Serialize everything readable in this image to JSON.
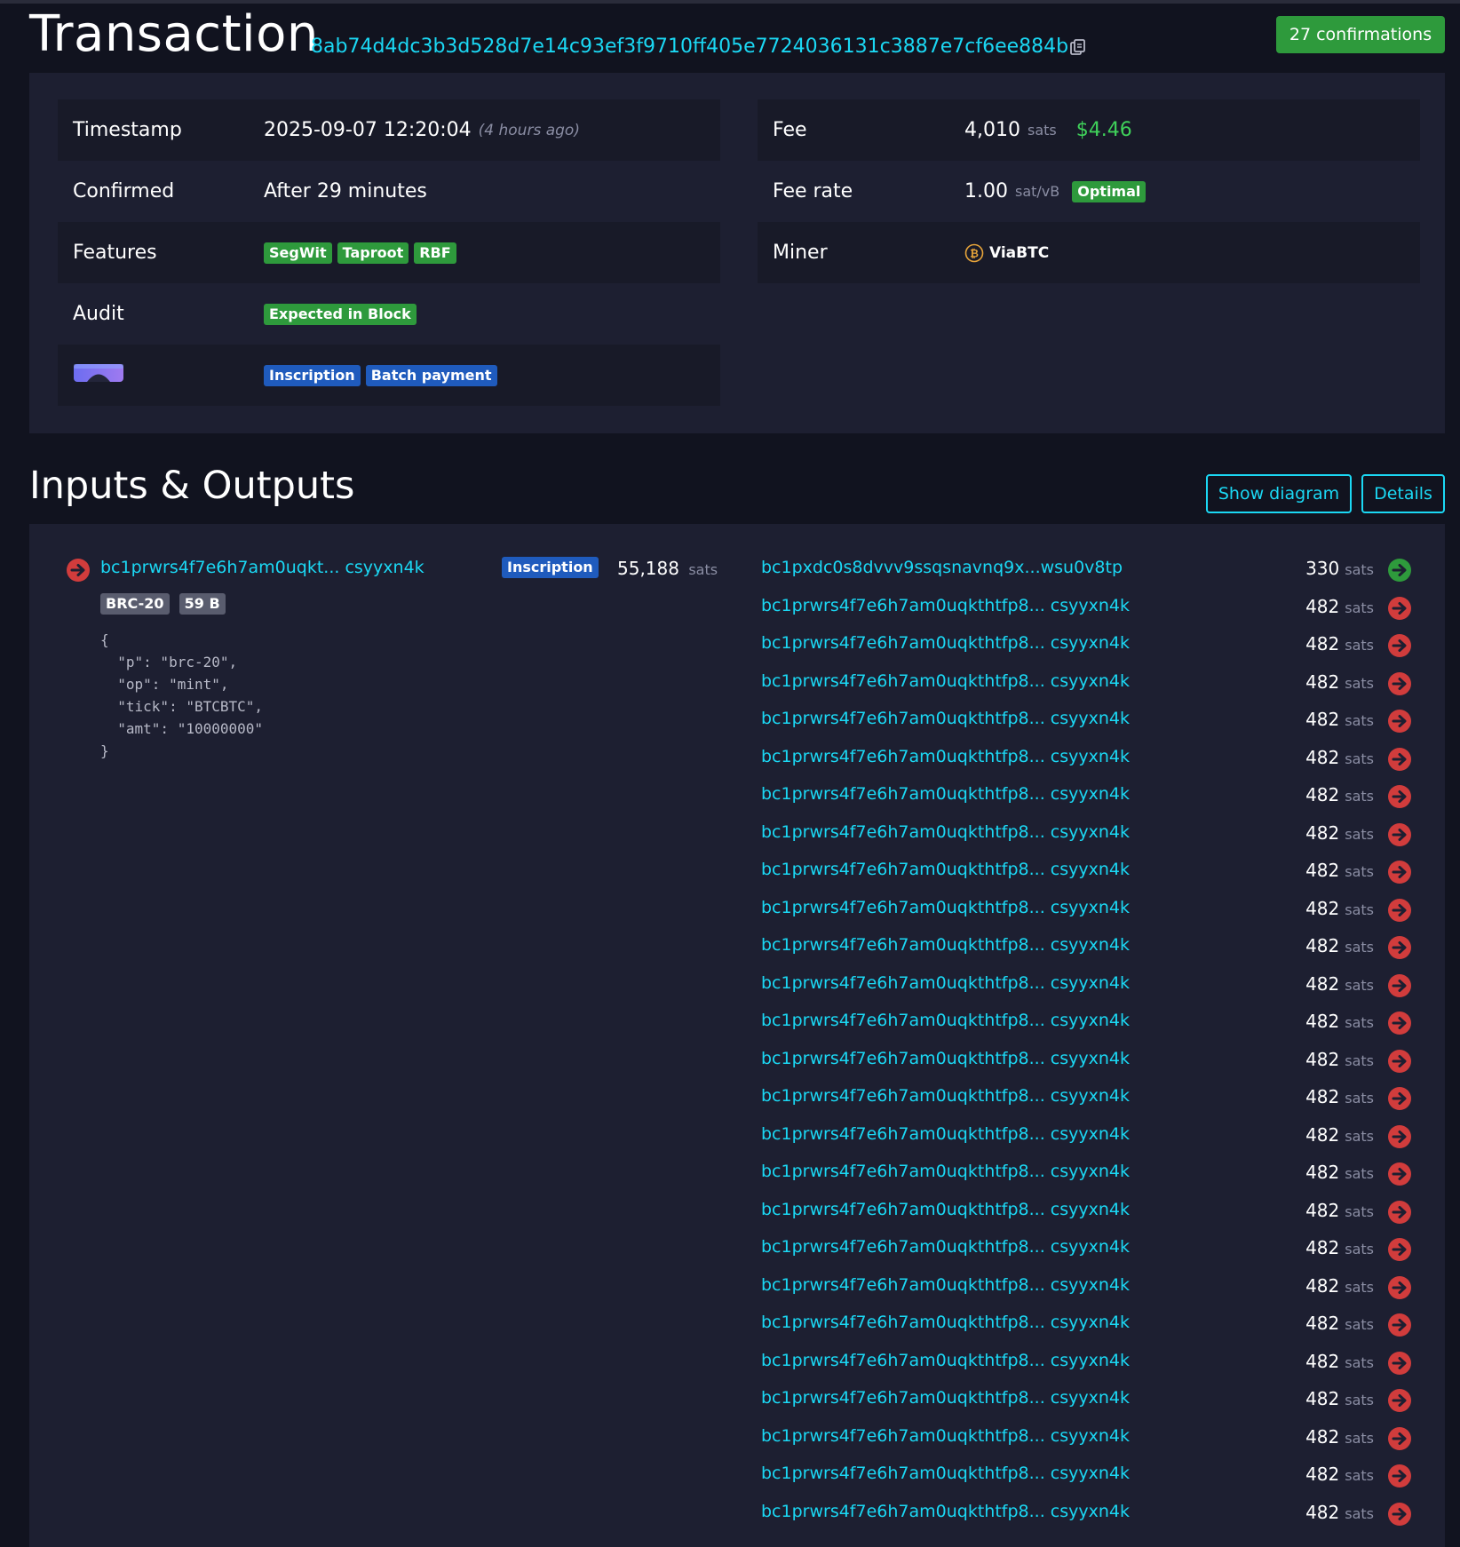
{
  "header": {
    "title": "Transaction",
    "txid": "8ab74d4dc3b3d528d7e14c93ef3f9710ff405e7724036131c3887e7cf6ee884b",
    "confirmations": "27 confirmations"
  },
  "details": {
    "timestamp": {
      "label": "Timestamp",
      "value": "2025-09-07 12:20:04",
      "relative": "(4 hours ago)"
    },
    "confirmed": {
      "label": "Confirmed",
      "value": "After 29 minutes"
    },
    "features": {
      "label": "Features",
      "tags": [
        "SegWit",
        "Taproot",
        "RBF"
      ]
    },
    "audit": {
      "label": "Audit",
      "tag": "Expected in Block"
    },
    "tags_row": {
      "tags": [
        "Inscription",
        "Batch payment"
      ]
    },
    "fee": {
      "label": "Fee",
      "value": "4,010",
      "unit": "sats",
      "usd": "$4.46"
    },
    "fee_rate": {
      "label": "Fee rate",
      "value": "1.00",
      "unit": "sat/vB",
      "tag": "Optimal"
    },
    "miner": {
      "label": "Miner",
      "name": "ViaBTC"
    }
  },
  "io": {
    "title": "Inputs & Outputs",
    "show_diagram": "Show diagram",
    "details": "Details",
    "input": {
      "address": "bc1prwrs4f7e6h7am0uqkt... csyyxn4k",
      "tag": "Inscription",
      "amount": "55,188",
      "unit": "sats",
      "badges": [
        "BRC-20",
        "59 B"
      ],
      "json": "{\n  \"p\": \"brc-20\",\n  \"op\": \"mint\",\n  \"tick\": \"BTCBTC\",\n  \"amt\": \"10000000\"\n}"
    },
    "outputs": [
      {
        "address": "bc1pxdc0s8dvvv9ssqsnavnq9x...wsu0v8tp",
        "amount": "330",
        "unit": "sats",
        "spent": false
      },
      {
        "address": "bc1prwrs4f7e6h7am0uqkthtfp8... csyyxn4k",
        "amount": "482",
        "unit": "sats",
        "spent": true
      },
      {
        "address": "bc1prwrs4f7e6h7am0uqkthtfp8... csyyxn4k",
        "amount": "482",
        "unit": "sats",
        "spent": true
      },
      {
        "address": "bc1prwrs4f7e6h7am0uqkthtfp8... csyyxn4k",
        "amount": "482",
        "unit": "sats",
        "spent": true
      },
      {
        "address": "bc1prwrs4f7e6h7am0uqkthtfp8... csyyxn4k",
        "amount": "482",
        "unit": "sats",
        "spent": true
      },
      {
        "address": "bc1prwrs4f7e6h7am0uqkthtfp8... csyyxn4k",
        "amount": "482",
        "unit": "sats",
        "spent": true
      },
      {
        "address": "bc1prwrs4f7e6h7am0uqkthtfp8... csyyxn4k",
        "amount": "482",
        "unit": "sats",
        "spent": true
      },
      {
        "address": "bc1prwrs4f7e6h7am0uqkthtfp8... csyyxn4k",
        "amount": "482",
        "unit": "sats",
        "spent": true
      },
      {
        "address": "bc1prwrs4f7e6h7am0uqkthtfp8... csyyxn4k",
        "amount": "482",
        "unit": "sats",
        "spent": true
      },
      {
        "address": "bc1prwrs4f7e6h7am0uqkthtfp8... csyyxn4k",
        "amount": "482",
        "unit": "sats",
        "spent": true
      },
      {
        "address": "bc1prwrs4f7e6h7am0uqkthtfp8... csyyxn4k",
        "amount": "482",
        "unit": "sats",
        "spent": true
      },
      {
        "address": "bc1prwrs4f7e6h7am0uqkthtfp8... csyyxn4k",
        "amount": "482",
        "unit": "sats",
        "spent": true
      },
      {
        "address": "bc1prwrs4f7e6h7am0uqkthtfp8... csyyxn4k",
        "amount": "482",
        "unit": "sats",
        "spent": true
      },
      {
        "address": "bc1prwrs4f7e6h7am0uqkthtfp8... csyyxn4k",
        "amount": "482",
        "unit": "sats",
        "spent": true
      },
      {
        "address": "bc1prwrs4f7e6h7am0uqkthtfp8... csyyxn4k",
        "amount": "482",
        "unit": "sats",
        "spent": true
      },
      {
        "address": "bc1prwrs4f7e6h7am0uqkthtfp8... csyyxn4k",
        "amount": "482",
        "unit": "sats",
        "spent": true
      },
      {
        "address": "bc1prwrs4f7e6h7am0uqkthtfp8... csyyxn4k",
        "amount": "482",
        "unit": "sats",
        "spent": true
      },
      {
        "address": "bc1prwrs4f7e6h7am0uqkthtfp8... csyyxn4k",
        "amount": "482",
        "unit": "sats",
        "spent": true
      },
      {
        "address": "bc1prwrs4f7e6h7am0uqkthtfp8... csyyxn4k",
        "amount": "482",
        "unit": "sats",
        "spent": true
      },
      {
        "address": "bc1prwrs4f7e6h7am0uqkthtfp8... csyyxn4k",
        "amount": "482",
        "unit": "sats",
        "spent": true
      },
      {
        "address": "bc1prwrs4f7e6h7am0uqkthtfp8... csyyxn4k",
        "amount": "482",
        "unit": "sats",
        "spent": true
      },
      {
        "address": "bc1prwrs4f7e6h7am0uqkthtfp8... csyyxn4k",
        "amount": "482",
        "unit": "sats",
        "spent": true
      },
      {
        "address": "bc1prwrs4f7e6h7am0uqkthtfp8... csyyxn4k",
        "amount": "482",
        "unit": "sats",
        "spent": true
      },
      {
        "address": "bc1prwrs4f7e6h7am0uqkthtfp8... csyyxn4k",
        "amount": "482",
        "unit": "sats",
        "spent": true
      },
      {
        "address": "bc1prwrs4f7e6h7am0uqkthtfp8... csyyxn4k",
        "amount": "482",
        "unit": "sats",
        "spent": true
      },
      {
        "address": "bc1prwrs4f7e6h7am0uqkthtfp8... csyyxn4k",
        "amount": "482",
        "unit": "sats",
        "spent": true
      }
    ]
  },
  "colors": {
    "background": "#11131f",
    "panel": "#1d1f31",
    "link": "#1bd8f4",
    "green": "#2e9a3c",
    "blue": "#1f5bbd",
    "red": "#d13c3c"
  }
}
